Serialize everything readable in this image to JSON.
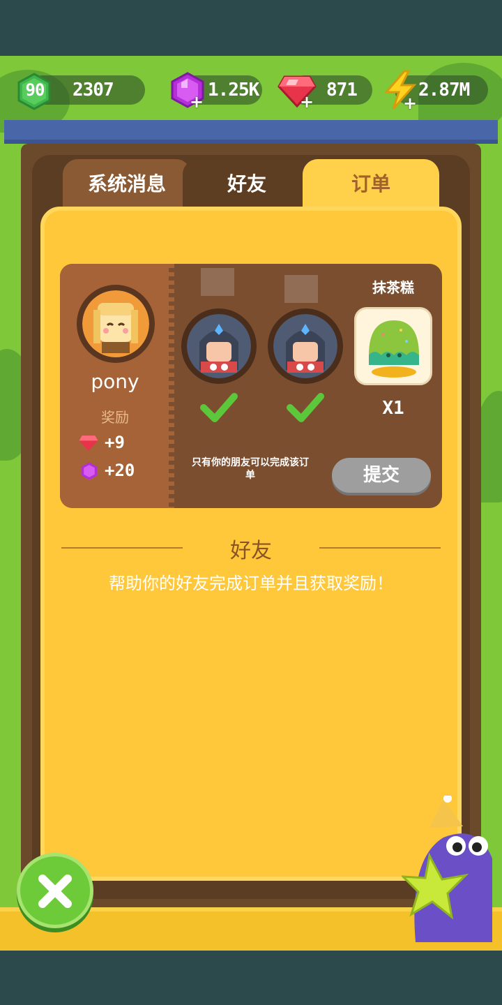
{
  "resources": {
    "level": "90",
    "xp": "2307",
    "purple_gems": "1.25K",
    "red_gems": "871",
    "energy": "2.87M"
  },
  "tabs": {
    "system": "系统消息",
    "friends": "好友",
    "orders": "订单"
  },
  "order": {
    "requester_name": "pony",
    "reward_label": "奖励",
    "reward_red": "+9",
    "reward_purple": "+20",
    "item_name": "抹茶糕",
    "item_qty": "X1",
    "notice": "只有你的朋友可以完成该订单",
    "submit_label": "提交"
  },
  "friends_section": {
    "heading": "好友",
    "description": "帮助你的好友完成订单并且获取奖励！"
  },
  "icons": [
    "level-badge-icon",
    "purple-gem-icon",
    "red-gem-icon",
    "energy-bolt-icon",
    "check-icon",
    "close-icon"
  ],
  "colors": {
    "panel": "#ffc83a",
    "card": "#7b4e30",
    "accent_green": "#6dcb3a",
    "tab_active_text": "#a0622a"
  }
}
